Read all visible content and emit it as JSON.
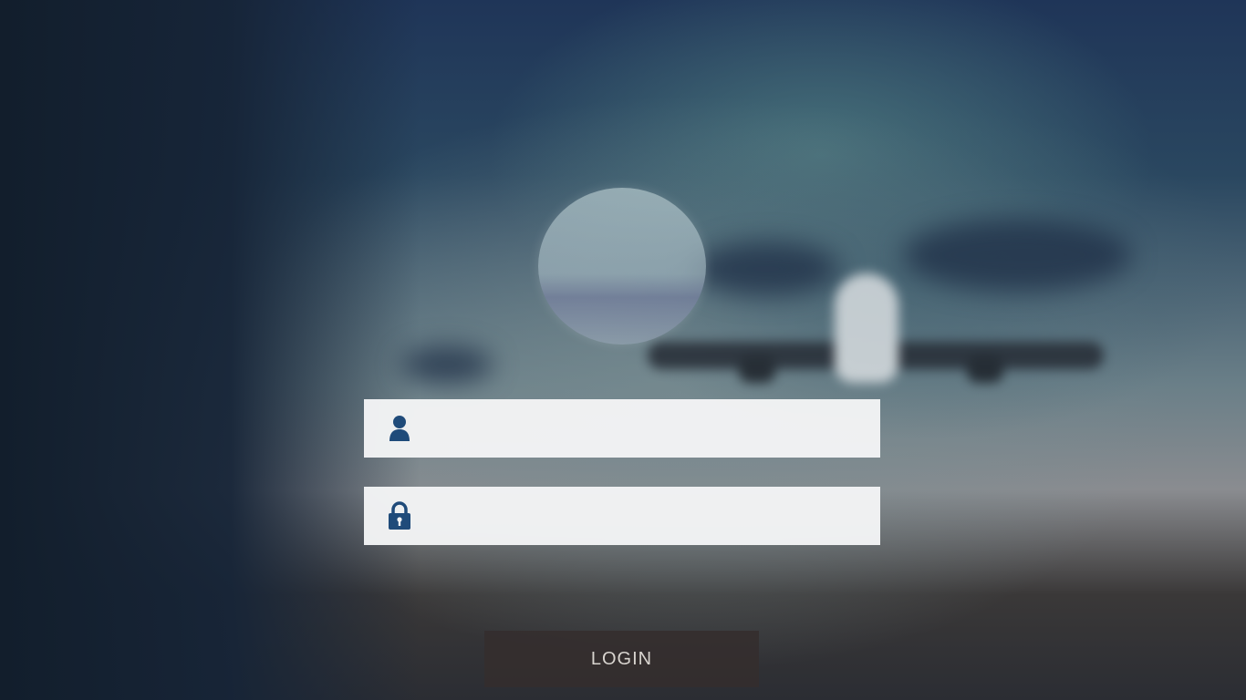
{
  "login_form": {
    "username": {
      "icon": "user-icon",
      "value": "",
      "placeholder": ""
    },
    "password": {
      "icon": "lock-icon",
      "value": "",
      "placeholder": ""
    },
    "login_label": "LOGIN"
  },
  "colors": {
    "icon": "#1f4b7a",
    "field_bg": "#f3f4f5",
    "button_bg": "#342d2d",
    "button_text": "#d8d4cf"
  }
}
